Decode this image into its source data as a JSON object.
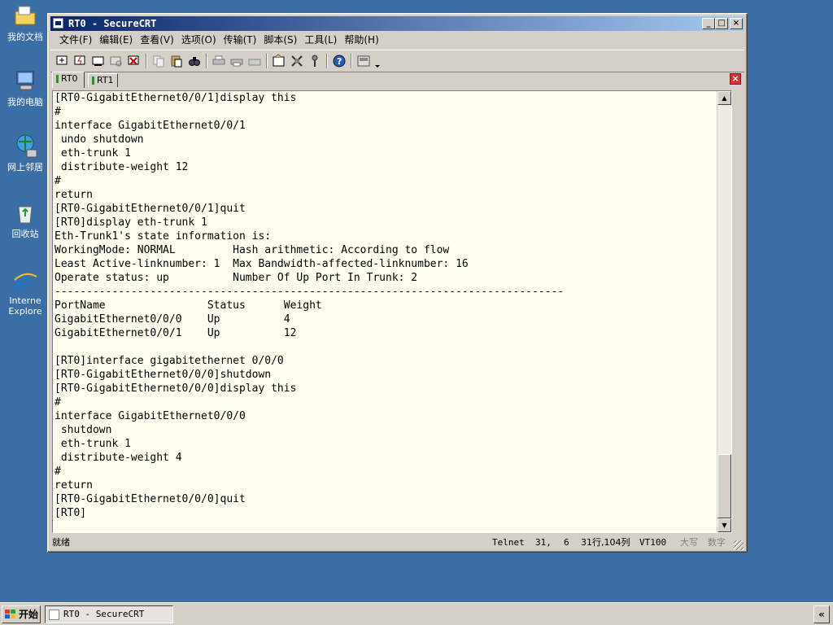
{
  "desktop": {
    "icons": [
      {
        "label": "我的文档",
        "icon": "folder-icon"
      },
      {
        "label": "我的电脑",
        "icon": "computer-icon"
      },
      {
        "label": "网上邻居",
        "icon": "network-icon"
      },
      {
        "label": "回收站",
        "icon": "recycle-bin-icon"
      },
      {
        "label": "Internet Explorer",
        "label_line1": "Interne",
        "label_line2": "Explore",
        "icon": "ie-icon"
      }
    ]
  },
  "window": {
    "title": "RT0 - SecureCRT",
    "buttons": {
      "minimize": "_",
      "maximize": "□",
      "close": "×"
    },
    "menu": [
      "文件(F)",
      "编辑(E)",
      "查看(V)",
      "选项(O)",
      "传输(T)",
      "脚本(S)",
      "工具(L)",
      "帮助(H)"
    ],
    "tabs": [
      {
        "label": "RT0",
        "active": true
      },
      {
        "label": "RT1",
        "active": false
      }
    ]
  },
  "terminal": {
    "lines": [
      "[RT0-GigabitEthernet0/0/1]display this",
      "#",
      "interface GigabitEthernet0/0/1",
      " undo shutdown",
      " eth-trunk 1",
      " distribute-weight 12",
      "#",
      "return",
      "[RT0-GigabitEthernet0/0/1]quit",
      "[RT0]display eth-trunk 1",
      "Eth-Trunk1's state information is:",
      "WorkingMode: NORMAL         Hash arithmetic: According to flow",
      "Least Active-linknumber: 1  Max Bandwidth-affected-linknumber: 16",
      "Operate status: up          Number Of Up Port In Trunk: 2",
      "--------------------------------------------------------------------------------",
      "PortName                Status      Weight",
      "GigabitEthernet0/0/0    Up          4",
      "GigabitEthernet0/0/1    Up          12",
      "",
      "[RT0]interface gigabitethernet 0/0/0",
      "[RT0-GigabitEthernet0/0/0]shutdown",
      "[RT0-GigabitEthernet0/0/0]display this",
      "#",
      "interface GigabitEthernet0/0/0",
      " shutdown",
      " eth-trunk 1",
      " distribute-weight 4",
      "#",
      "return",
      "[RT0-GigabitEthernet0/0/0]quit",
      "[RT0]"
    ]
  },
  "statusbar": {
    "ready": "就绪",
    "protocol": "Telnet",
    "row": "31,",
    "col": "6",
    "size": "31行,104列",
    "emulation": "VT100",
    "caps": "大写",
    "num": "数字"
  },
  "taskbar": {
    "start_label": "开始",
    "task_label": "RT0 - SecureCRT",
    "tray_label": "«"
  }
}
